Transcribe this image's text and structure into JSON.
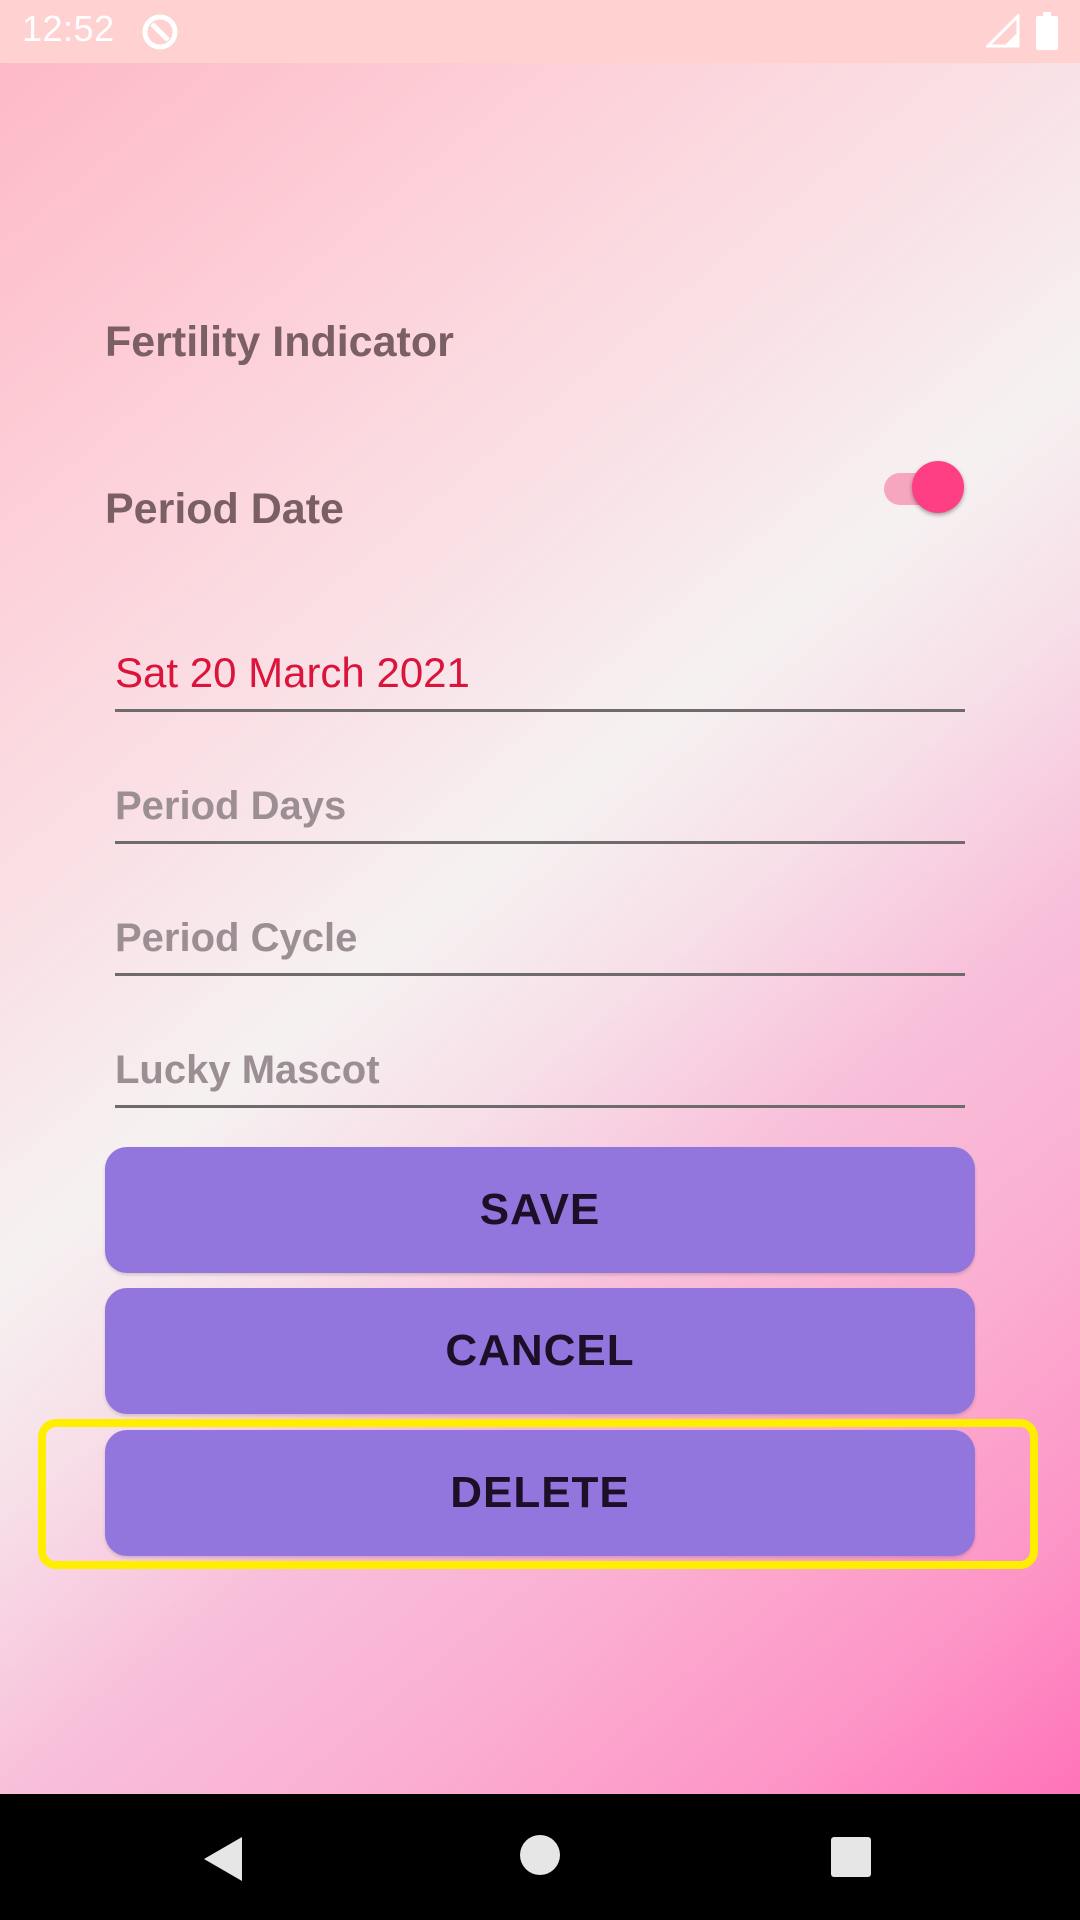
{
  "status_bar": {
    "time": "12:52",
    "icons": [
      "notification-icon",
      "signal-icon",
      "battery-icon"
    ]
  },
  "form": {
    "fertility_label": "Fertility Indicator",
    "fertility_toggle_on": true,
    "period_date_label": "Period Date",
    "period_date_value": "Sat 20 March 2021",
    "period_days_placeholder": "Period Days",
    "period_cycle_placeholder": "Period Cycle",
    "lucky_mascot_placeholder": "Lucky Mascot"
  },
  "buttons": {
    "save": "SAVE",
    "cancel": "CANCEL",
    "delete": "DELETE"
  },
  "nav_bar": {
    "icons": [
      "back-icon",
      "home-icon",
      "recent-apps-icon"
    ]
  },
  "colors": {
    "accent": "#ff3f83",
    "button": "#9376dd",
    "date_text": "#dc143c",
    "highlight": "#ffee00"
  }
}
